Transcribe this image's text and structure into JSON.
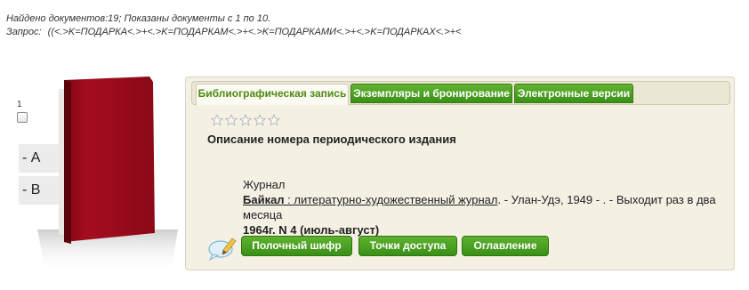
{
  "search_summary": {
    "found_line": "Найдено документов:19; Показаны документы с 1 по 10.",
    "query_label": "Запрос:",
    "query_value": "((<.>K=ПОДАРКА<.>+<.>K=ПОДАРКАМ<.>+<.>K=ПОДАРКАМИ<.>+<.>K=ПОДАРКАХ<.>+<"
  },
  "record": {
    "number": "1",
    "checkbox_checked": false,
    "side_menu": [
      "- А",
      "- В"
    ],
    "tabs": [
      {
        "label": "Библиографическая запись",
        "active": true
      },
      {
        "label": "Экземпляры и бронирование",
        "active": false
      },
      {
        "label": "Электронные версии",
        "active": false
      }
    ],
    "rating_stars": 5,
    "rating_value": 0,
    "title": "Описание номера периодического издания",
    "doc_type": "Журнал",
    "main_title": "Байкал",
    "subtitle": " : литературно-художественный журнал",
    "rest_text": ". - Улан-Удэ, 1949 - . - Выходит раз в два месяца",
    "issue": "1964г. N 4 (июль-август)",
    "buttons": [
      "Полочный шифр",
      "Точки доступа",
      "Оглавление"
    ]
  },
  "colors": {
    "accent_green": "#3f9418",
    "book_red": "#9e0b1c",
    "panel_bg": "#f4f1e4"
  },
  "icons": [
    "book-cover-icon",
    "star-icon",
    "comment-edit-icon"
  ]
}
